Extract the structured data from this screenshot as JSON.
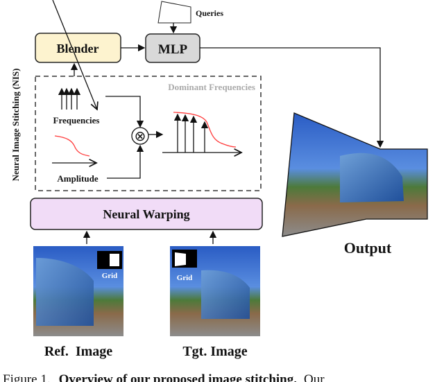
{
  "diagram": {
    "side_label": "Neural Image Stitching (NIS)",
    "blender": "Blender",
    "mlp": "MLP",
    "queries": "Queries",
    "dominant_frequencies": "Dominant Frequencies",
    "frequencies": "Frequencies",
    "amplitude": "Amplitude",
    "multiply_symbol": "⊗",
    "neural_warping": "Neural Warping",
    "ref_image": "Ref.  Image",
    "tgt_image": "Tgt. Image",
    "grid": "Grid",
    "output": "Output",
    "colors": {
      "blender": "#fdf3cf",
      "mlp": "#d9d9d9",
      "warping": "#f1dcf7",
      "curve": "#ff3b3b",
      "sky": "#2f63c9"
    }
  },
  "caption": {
    "prefix": "Figure 1.",
    "bold": "Overview of our proposed image stitching.",
    "rest": "Our"
  }
}
